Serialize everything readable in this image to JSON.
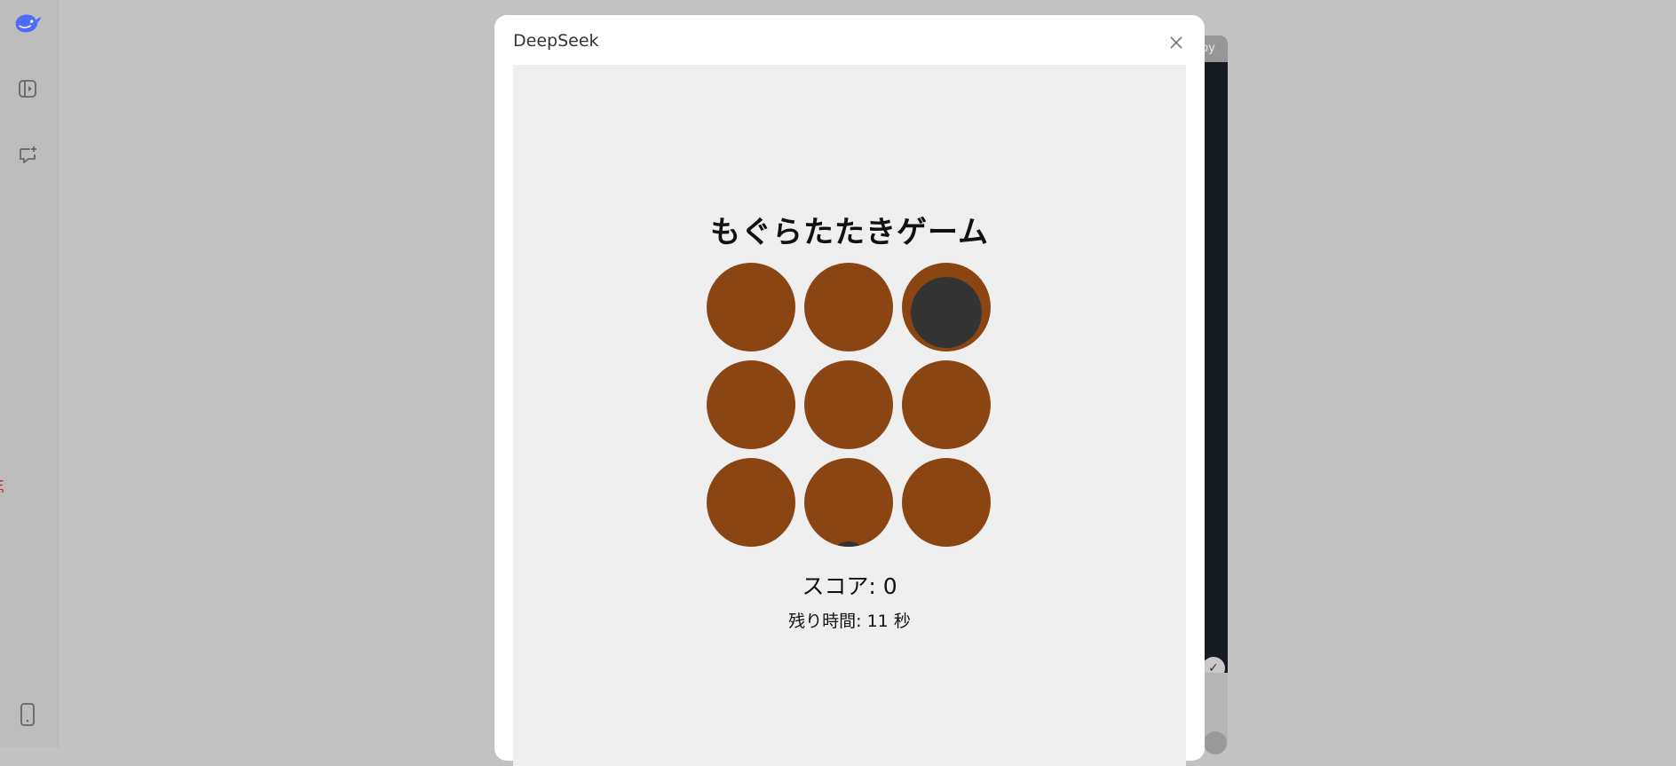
{
  "sidebar": {
    "items": [
      {
        "icon": "deepseek-logo-icon"
      },
      {
        "icon": "sidebar-toggle-icon"
      },
      {
        "icon": "new-chat-icon"
      },
      {
        "icon": "mobile-app-icon"
      }
    ]
  },
  "background_panel": {
    "header_partial_text": "py"
  },
  "modal": {
    "title": "DeepSeek",
    "close_icon": "close-icon"
  },
  "game": {
    "title": "もぐらたたきゲーム",
    "score_text": "スコア: 0",
    "timer_text": "残り時間: 11 秒",
    "grid": {
      "rows": 3,
      "cols": 3,
      "moles": [
        {
          "index": 2,
          "state": "up"
        },
        {
          "index": 7,
          "state": "peeking"
        }
      ]
    },
    "colors": {
      "hole": "#8b4513",
      "mole": "#333333",
      "background": "#efefef"
    }
  }
}
